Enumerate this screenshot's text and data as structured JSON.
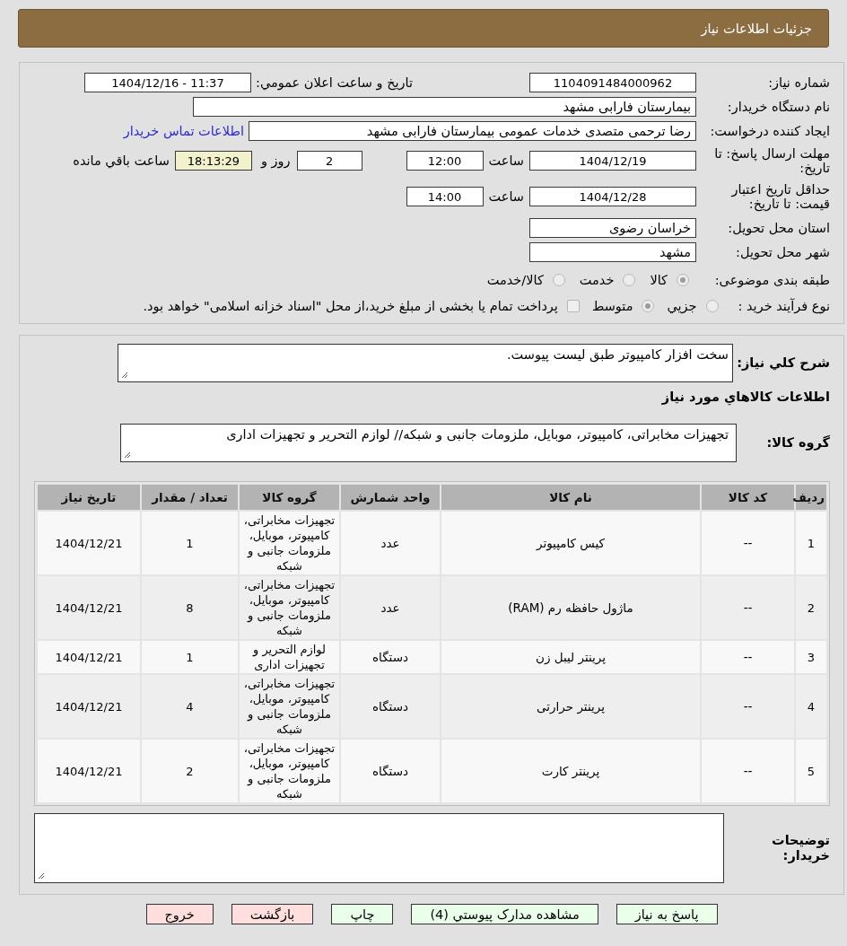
{
  "header": {
    "title": "جزئیات اطلاعات نیاز"
  },
  "details": {
    "need_number": {
      "label": "شماره نیاز:",
      "value": "1104091484000962"
    },
    "announcement": {
      "label": "تاریخ و ساعت اعلان عمومي:",
      "value": "1404/12/16 - 11:37"
    },
    "buyer_org": {
      "label": "نام دستگاه خریدار:",
      "value": "بیمارستان فارابی مشهد"
    },
    "requester": {
      "label": "ایجاد کننده درخواست:",
      "value": "رضا ترحمی متصدی خدمات عمومی بیمارستان فارابی مشهد",
      "contact_link": "اطلاعات تماس خریدار"
    },
    "reply_deadline": {
      "label": "مهلت ارسال پاسخ: تا تاریخ:",
      "date": "1404/12/19",
      "time_label": "ساعت",
      "time": "12:00",
      "days": "2",
      "days_label": "روز و",
      "remaining": "18:13:29",
      "remaining_label": "ساعت باقي مانده"
    },
    "price_validity": {
      "label": "حداقل تاریخ اعتبار قیمت: تا تاریخ:",
      "date": "1404/12/28",
      "time_label": "ساعت",
      "time": "14:00"
    },
    "province": {
      "label": "استان محل تحویل:",
      "value": "خراسان رضوی"
    },
    "city": {
      "label": "شهر محل تحویل:",
      "value": "مشهد"
    },
    "category": {
      "label": "طبقه بندی موضوعی:",
      "disabled": true,
      "options": [
        {
          "label": "کالا",
          "selected": true
        },
        {
          "label": "خدمت",
          "selected": false
        },
        {
          "label": "کالا/خدمت",
          "selected": false
        }
      ]
    },
    "purchase_process": {
      "label": "نوع فرآیند خرید :",
      "disabled": true,
      "options": [
        {
          "label": "جزيي",
          "selected": false
        },
        {
          "label": "متوسط",
          "selected": true
        }
      ],
      "treasury_payment": {
        "label": "پرداخت تمام یا بخشی از مبلغ خرید،از محل \"اسناد خزانه اسلامی\" خواهد بود.",
        "checked": false,
        "disabled": true
      }
    }
  },
  "needs": {
    "description": {
      "label": "شرح کلي نیاز:",
      "value": "سخت افزار کامپیوتر طبق لیست پیوست."
    },
    "goods_heading": "اطلاعات کالاهاي مورد نیاز",
    "goods_group": {
      "label": "گروه کالا:",
      "value": "تجهیزات مخابراتی، کامپیوتر، موبایل، ملزومات جانبی و شبکه// لوازم التحریر و تجهیزات اداری"
    },
    "table": {
      "columns": [
        "ردیف",
        "کد کالا",
        "نام کالا",
        "واحد شمارش",
        "گروه کالا",
        "تعداد / مقدار",
        "تاریخ نیاز"
      ],
      "rows": [
        [
          "1",
          "--",
          "کیس کامپیوتر",
          "عدد",
          "تجهیزات مخابراتی، کامپیوتر، موبایل، ملزومات جانبی و شبکه",
          "1",
          "1404/12/21"
        ],
        [
          "2",
          "--",
          "ماژول حافظه رم (RAM)",
          "عدد",
          "تجهیزات مخابراتی، کامپیوتر، موبایل، ملزومات جانبی و شبکه",
          "8",
          "1404/12/21"
        ],
        [
          "3",
          "--",
          "پرینتر لیبل زن",
          "دستگاه",
          "لوازم التحریر و تجهیزات اداری",
          "1",
          "1404/12/21"
        ],
        [
          "4",
          "--",
          "پرینتر حرارتی",
          "دستگاه",
          "تجهیزات مخابراتی، کامپیوتر، موبایل، ملزومات جانبی و شبکه",
          "4",
          "1404/12/21"
        ],
        [
          "5",
          "--",
          "پرینتر کارت",
          "دستگاه",
          "تجهیزات مخابراتی، کامپیوتر، موبایل، ملزومات جانبی و شبکه",
          "2",
          "1404/12/21"
        ]
      ]
    },
    "buyer_notes": {
      "label": "توضیحات خریدار:"
    }
  },
  "buttons": [
    {
      "label": "پاسخ به نیاز",
      "kind": "action"
    },
    {
      "label": "مشاهده مدارک پیوستي (4)",
      "kind": "action"
    },
    {
      "label": "چاپ",
      "kind": "action"
    },
    {
      "label": "بازگشت",
      "kind": "exit"
    },
    {
      "label": "خروج",
      "kind": "exit"
    }
  ]
}
